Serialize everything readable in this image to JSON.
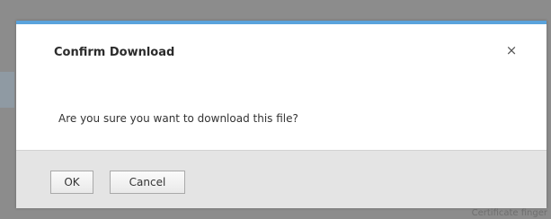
{
  "background": {
    "hint_text": "Certificate finger"
  },
  "dialog": {
    "title": "Confirm Download",
    "close_glyph": "×",
    "message": "Are you sure you want to download this file?",
    "ok_label": "OK",
    "cancel_label": "Cancel"
  },
  "colors": {
    "accent": "#5aa3dc",
    "footer": "#e4e4e4",
    "overlay": "#8c8c8c"
  }
}
